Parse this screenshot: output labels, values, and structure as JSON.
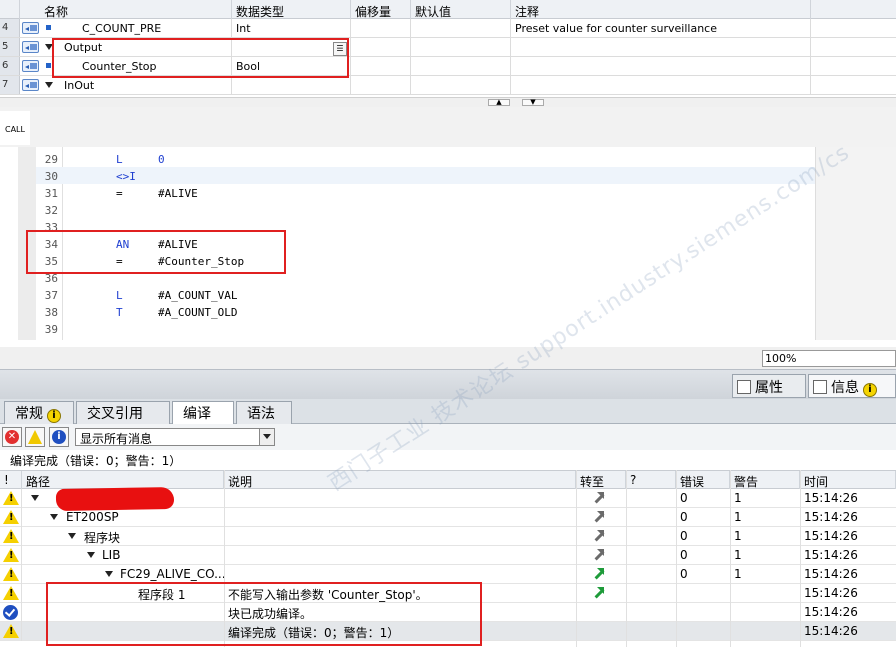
{
  "interface": {
    "headers": [
      "名称",
      "数据类型",
      "偏移量",
      "默认值",
      "注释"
    ],
    "rows": [
      {
        "num": "4",
        "name": "C_COUNT_PRE",
        "type": "Int",
        "comment": "Preset value for counter surveillance"
      },
      {
        "num": "5",
        "name": "Output",
        "type": "",
        "comment": ""
      },
      {
        "num": "6",
        "name": "Counter_Stop",
        "type": "Bool",
        "comment": ""
      },
      {
        "num": "7",
        "name": "InOut",
        "type": "",
        "comment": ""
      }
    ]
  },
  "call_label": "CALL",
  "code": {
    "lines": [
      {
        "num": "29",
        "ins": "L",
        "op": "0"
      },
      {
        "num": "30",
        "ins": "<>I",
        "op": ""
      },
      {
        "num": "31",
        "ins": "=",
        "op": "#ALIVE"
      },
      {
        "num": "32",
        "ins": "",
        "op": ""
      },
      {
        "num": "33",
        "ins": "",
        "op": ""
      },
      {
        "num": "34",
        "ins": "AN",
        "op": "#ALIVE"
      },
      {
        "num": "35",
        "ins": "=",
        "op": "#Counter_Stop"
      },
      {
        "num": "36",
        "ins": "",
        "op": ""
      },
      {
        "num": "37",
        "ins": "L",
        "op": "#A_COUNT_VAL"
      },
      {
        "num": "38",
        "ins": "T",
        "op": "#A_COUNT_OLD"
      },
      {
        "num": "39",
        "ins": "",
        "op": ""
      }
    ]
  },
  "zoom": "100%",
  "inspector": {
    "properties_label": "属性",
    "info_label": "信息",
    "info_badge": "i",
    "tabs": [
      {
        "label": "常规",
        "badge": "i"
      },
      {
        "label": "交叉引用"
      },
      {
        "label": "编译"
      },
      {
        "label": "语法"
      }
    ],
    "filter_select": "显示所有消息",
    "status": "编译完成（错误：0；警告：1）",
    "headers": {
      "excl": "!",
      "path": "路径",
      "desc": "说明",
      "goto": "转至",
      "q": "?",
      "errors": "错误",
      "warnings": "警告",
      "time": "时间"
    },
    "messages": [
      {
        "icon": "warning",
        "path": "",
        "desc": "",
        "goto": "gray",
        "errors": "0",
        "warnings": "1",
        "time": "15:14:26"
      },
      {
        "icon": "warning",
        "path": "ET200SP",
        "desc": "",
        "goto": "gray",
        "errors": "0",
        "warnings": "1",
        "time": "15:14:26"
      },
      {
        "icon": "warning",
        "path": "程序块",
        "desc": "",
        "goto": "gray",
        "errors": "0",
        "warnings": "1",
        "time": "15:14:26"
      },
      {
        "icon": "warning",
        "path": "LIB",
        "desc": "",
        "goto": "gray",
        "errors": "0",
        "warnings": "1",
        "time": "15:14:26"
      },
      {
        "icon": "warning",
        "path": "FC29_ALIVE_CO...",
        "desc": "",
        "goto": "green",
        "errors": "0",
        "warnings": "1",
        "time": "15:14:26"
      },
      {
        "icon": "warning",
        "path": "程序段 1",
        "desc": "不能写入输出参数 'Counter_Stop'。",
        "goto": "green",
        "errors": "",
        "warnings": "",
        "time": "15:14:26"
      },
      {
        "icon": "ok",
        "path": "",
        "desc": "块已成功编译。",
        "goto": "",
        "errors": "",
        "warnings": "",
        "time": "15:14:26"
      },
      {
        "icon": "warning",
        "path": "",
        "desc": "编译完成（错误：0；警告：1）",
        "goto": "",
        "errors": "",
        "warnings": "",
        "time": "15:14:26"
      }
    ]
  },
  "watermark": "西门子工业 技术论坛 support.industry.siemens.com/cs"
}
